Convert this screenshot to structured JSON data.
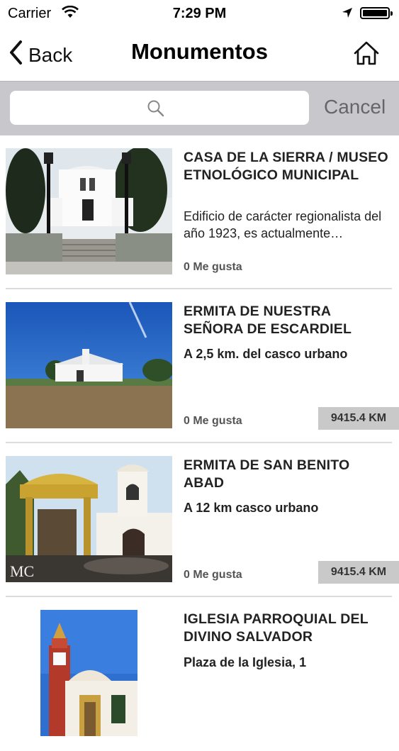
{
  "status_bar": {
    "carrier": "Carrier",
    "time": "7:29 PM"
  },
  "nav": {
    "back_label": "Back",
    "title": "Monumentos"
  },
  "search": {
    "placeholder": "",
    "cancel_label": "Cancel"
  },
  "items": [
    {
      "name": "CASA DE LA SIERRA / MUSEO ETNOLÓGICO MUNICIPAL",
      "description": "Edificio de carácter regionalista del año 1923, es actualmente…",
      "likes": "0 Me gusta",
      "distance": ""
    },
    {
      "name": "ERMITA DE NUESTRA SEÑORA DE ESCARDIEL",
      "description": "A 2,5 km. del casco urbano",
      "likes": "0 Me gusta",
      "distance": "9415.4 KM"
    },
    {
      "name": "ERMITA DE SAN BENITO ABAD",
      "description": "A 12 km casco urbano",
      "likes": "0 Me gusta",
      "distance": "9415.4 KM",
      "watermark": "MC"
    },
    {
      "name": "IGLESIA PARROQUIAL DEL DIVINO SALVADOR",
      "description": "Plaza de la Iglesia, 1",
      "likes": "",
      "distance": ""
    }
  ]
}
